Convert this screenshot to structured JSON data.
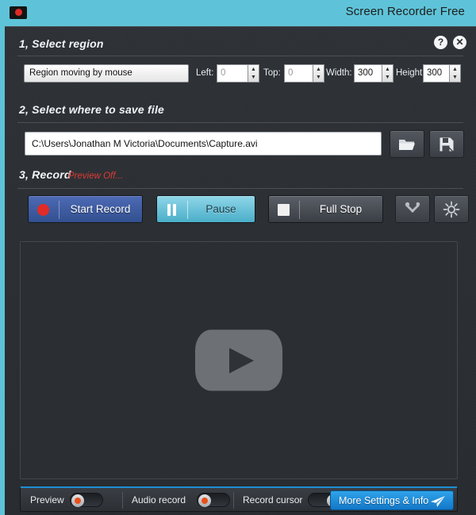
{
  "window": {
    "title": "Screen Recorder Free",
    "app_icon": "screen-record-icon",
    "accent_cyan": "#5ec3d8",
    "accent_blue": "#1d8fd4"
  },
  "header_buttons": {
    "help": "?",
    "close": "✕"
  },
  "section1": {
    "heading": "1, Select region",
    "region_mode": "Region moving by mouse",
    "fields": [
      {
        "label": "Left:",
        "value": "0",
        "muted": true
      },
      {
        "label": "Top:",
        "value": "0",
        "muted": true
      },
      {
        "label": "Width:",
        "value": "300",
        "muted": false
      },
      {
        "label": "Height",
        "value": "300",
        "muted": false
      }
    ],
    "spinner_up": "▲",
    "spinner_down": "▼",
    "dropdown_chevron": "ⱟ"
  },
  "section2": {
    "heading": "2, Select where to save file",
    "save_path": "C:\\Users\\Jonathan M Victoria\\Documents\\Capture.avi",
    "browse_icon": "folder-open-icon",
    "save_as_icon": "floppy-save-icon"
  },
  "section3": {
    "heading": "3, Record",
    "preview_status": "Preview Off...",
    "buttons": [
      {
        "label": "Start Record",
        "icon": "record-dot-icon"
      },
      {
        "label": "Pause",
        "icon": "pause-icon"
      },
      {
        "label": "Full Stop",
        "icon": "stop-square-icon"
      }
    ],
    "tools_icon": "wrench-tools-icon",
    "brightness_icon": "brightness-sun-icon"
  },
  "preview_panel": {
    "play_icon": "play-button-icon"
  },
  "bottom_bar": {
    "toggles": [
      {
        "label": "Preview",
        "state": "off"
      },
      {
        "label": "Audio record",
        "state": "off"
      },
      {
        "label": "Record cursor",
        "state": "on"
      }
    ],
    "more_button": {
      "label": "More Settings & Info",
      "icon": "paper-plane-icon"
    }
  }
}
